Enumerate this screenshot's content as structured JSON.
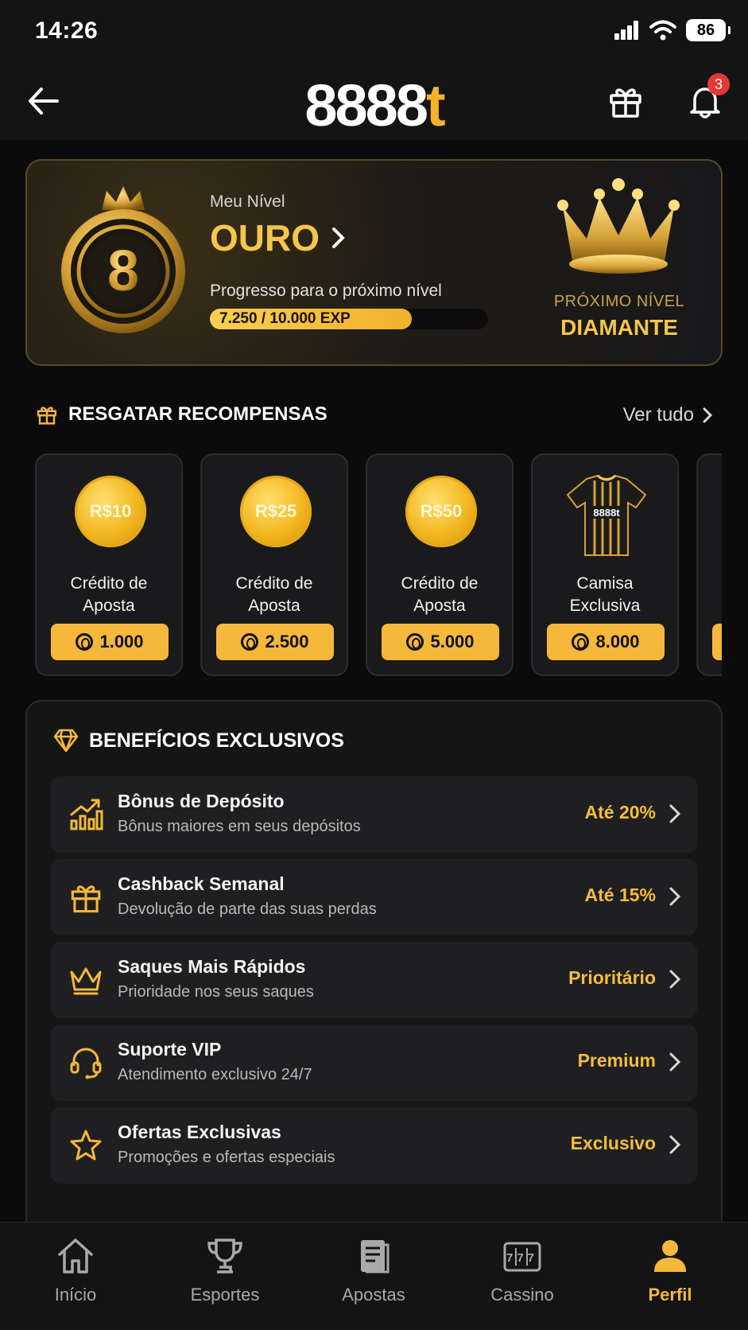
{
  "status_bar": {
    "time": "14:26",
    "battery": "86"
  },
  "header": {
    "logo_main": "8888",
    "logo_accent": "t",
    "notification_count": "3"
  },
  "level": {
    "label": "Meu Nível",
    "name": "OURO",
    "medal_number": "8",
    "progress_label": "Progresso para o próximo nível",
    "progress_text": "7.250 / 10.000 EXP",
    "progress_fraction": 0.725,
    "next_label": "PRÓXIMO NÍVEL",
    "next_name": "DIAMANTE"
  },
  "rewards": {
    "title": "RESGATAR RECOMPENSAS",
    "see_all": "Ver tudo",
    "items": [
      {
        "value": "R$10",
        "name_line1": "Crédito de",
        "name_line2": "Aposta",
        "cost": "1.000"
      },
      {
        "value": "R$25",
        "name_line1": "Crédito de",
        "name_line2": "Aposta",
        "cost": "2.500"
      },
      {
        "value": "R$50",
        "name_line1": "Crédito de",
        "name_line2": "Aposta",
        "cost": "5.000"
      },
      {
        "value": "8888t",
        "name_line1": "Camisa",
        "name_line2": "Exclusiva",
        "cost": "8.000"
      }
    ]
  },
  "benefits": {
    "title": "BENEFÍCIOS EXCLUSIVOS",
    "items": [
      {
        "icon": "chart-growth-icon",
        "name": "Bônus de Depósito",
        "desc": "Bônus maiores em seus depósitos",
        "value": "Até 20%"
      },
      {
        "icon": "gift-icon",
        "name": "Cashback Semanal",
        "desc": "Devolução de parte das suas perdas",
        "value": "Até 15%"
      },
      {
        "icon": "crown-icon",
        "name": "Saques Mais Rápidos",
        "desc": "Prioridade nos seus saques",
        "value": "Prioritário"
      },
      {
        "icon": "headset-icon",
        "name": "Suporte VIP",
        "desc": "Atendimento exclusivo 24/7",
        "value": "Premium"
      },
      {
        "icon": "star-icon",
        "name": "Ofertas Exclusivas",
        "desc": "Promoções e ofertas especiais",
        "value": "Exclusivo"
      }
    ]
  },
  "nav": {
    "items": [
      {
        "label": "Início",
        "icon": "home-icon"
      },
      {
        "label": "Esportes",
        "icon": "trophy-icon"
      },
      {
        "label": "Apostas",
        "icon": "bet-slip-icon"
      },
      {
        "label": "Cassino",
        "icon": "slot-machine-icon",
        "reels": "777"
      },
      {
        "label": "Perfil",
        "icon": "profile-icon",
        "active": true
      }
    ]
  },
  "colors": {
    "accent": "#f5b83a",
    "background": "#0b0b0c",
    "card": "#1f1f21"
  }
}
